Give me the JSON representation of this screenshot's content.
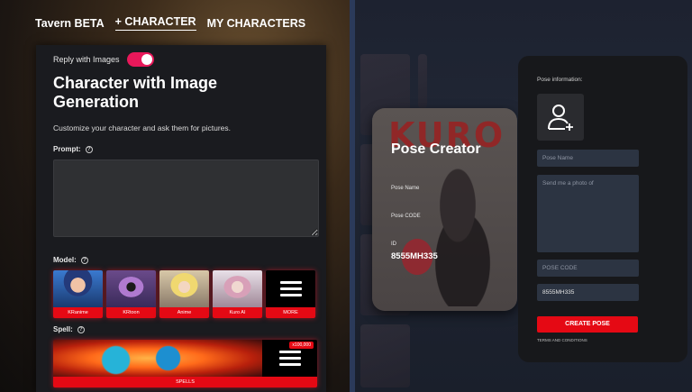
{
  "nav": {
    "brand": "Tavern BETA",
    "tabs": [
      {
        "label": "+ CHARACTER",
        "active": true
      },
      {
        "label": "MY CHARACTERS",
        "active": false
      }
    ]
  },
  "character_panel": {
    "toggle_label": "Reply with Images",
    "toggle_on": true,
    "title": "Character with Image Generation",
    "subtitle": "Customize your character and ask them for pictures.",
    "prompt_label": "Prompt:",
    "prompt_value": "",
    "model_label": "Model:",
    "models": [
      {
        "name": "KRanime"
      },
      {
        "name": "KRtoon"
      },
      {
        "name": "Anime"
      },
      {
        "name": "Kuro AI"
      },
      {
        "name": "MORE"
      }
    ],
    "spell_label": "Spell:",
    "spell_badge": "x100,000",
    "spell_caption": "SPELLS"
  },
  "pose_card": {
    "logo": "KURO",
    "heading": "Pose Creator",
    "pose_name_label": "Pose Name",
    "pose_code_label": "Pose CODE",
    "id_label": "ID",
    "id_value": "8555MH335"
  },
  "pose_info": {
    "header": "Pose information:",
    "pose_name_placeholder": "Pose Name",
    "description_placeholder": "Send me a photo of",
    "pose_code_placeholder": "POSE CODE",
    "id_value": "8555MH335",
    "create_button": "CREATE POSE",
    "terms": "TERMS AND CONDITIONS"
  },
  "colors": {
    "accent_red": "#e50914",
    "toggle_pink": "#e8185a",
    "panel_bg": "#1a1b1f"
  }
}
